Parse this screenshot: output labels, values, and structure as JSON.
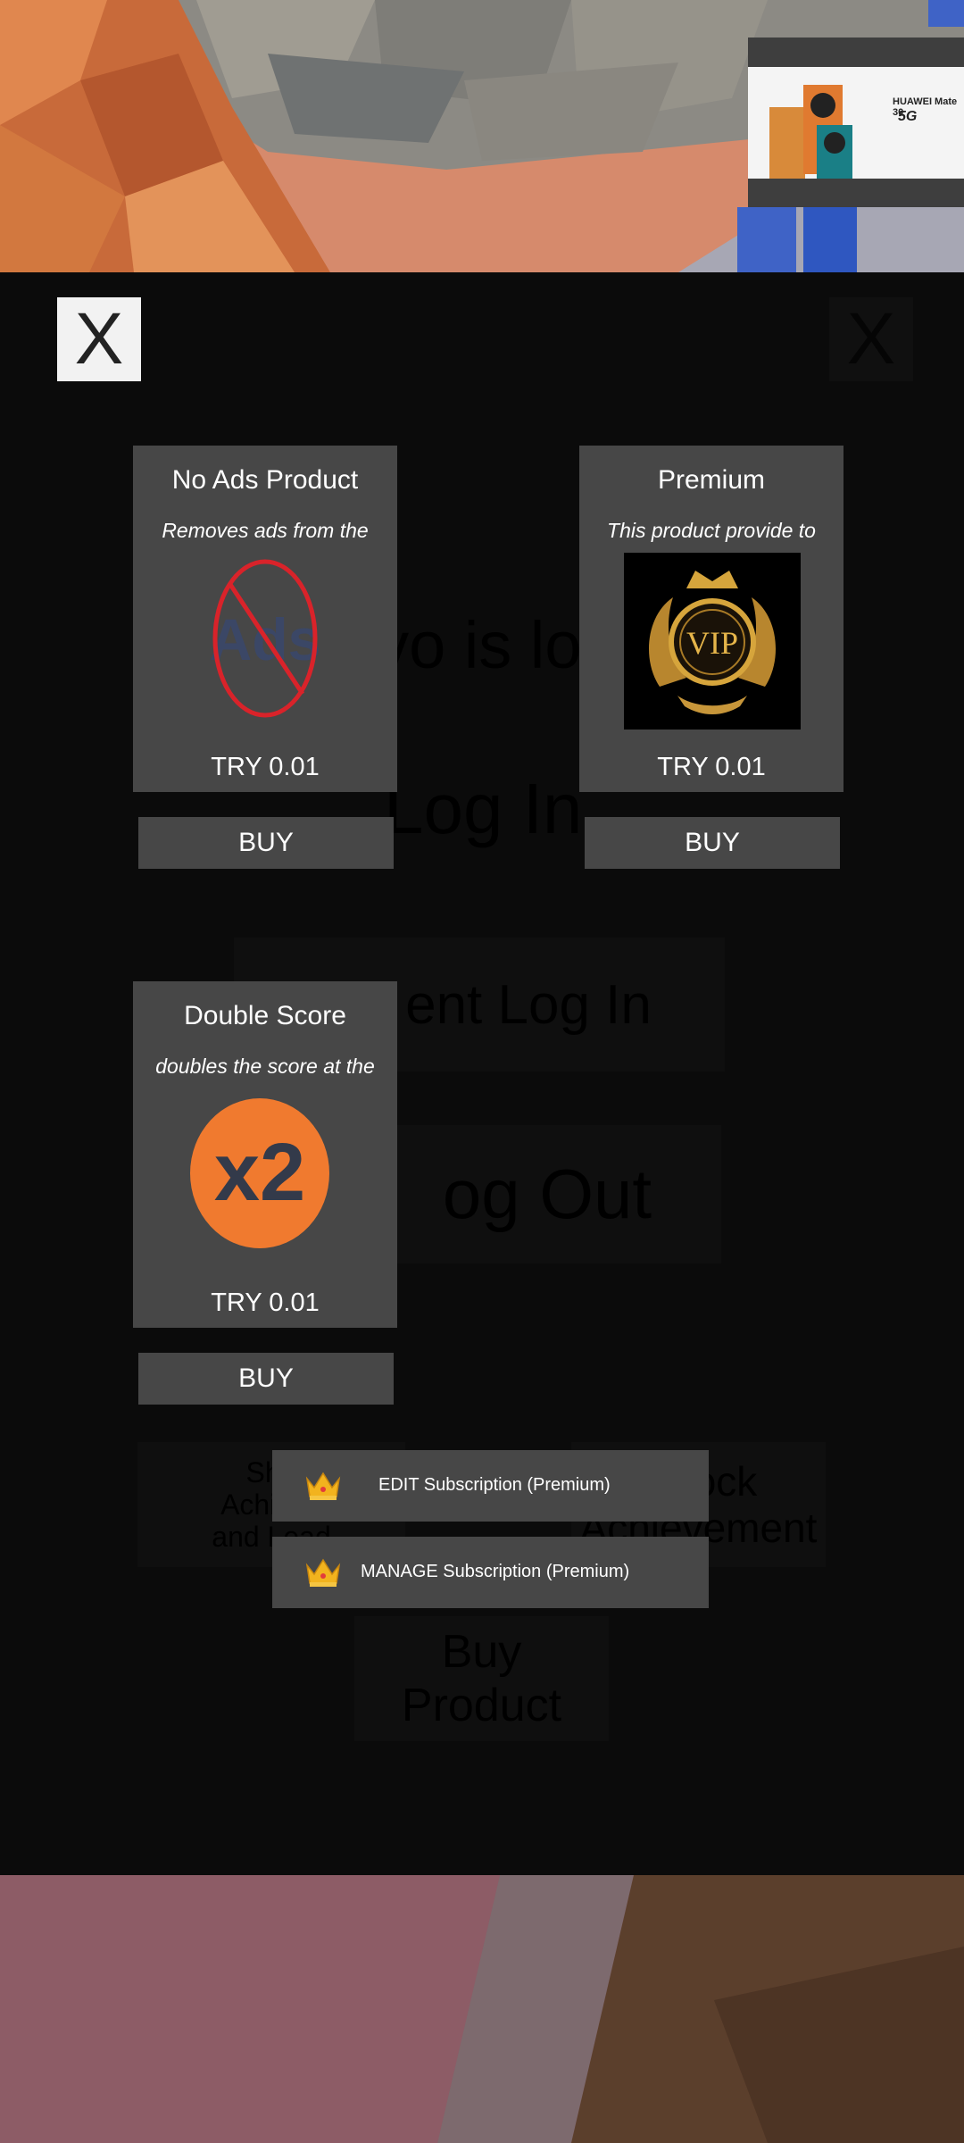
{
  "close_button_label": "X",
  "background_menu": {
    "line1": "ovo is lo",
    "log_in": "Log In",
    "silent_log_in": "ent Log In",
    "log_out": "og Out",
    "show_achievements": [
      "Sho",
      "Achieve",
      "and Lead"
    ],
    "unlock_achievement": [
      "ock",
      "Achievement"
    ],
    "buy_product": [
      "Buy",
      "Product"
    ]
  },
  "products": [
    {
      "title": "No Ads Product",
      "description": "Removes ads from the",
      "price": "TRY 0.01",
      "buy_label": "BUY",
      "icon": "no-ads-icon"
    },
    {
      "title": "Premium",
      "description": "This product provide to",
      "price": "TRY 0.01",
      "buy_label": "BUY",
      "icon": "vip-icon",
      "icon_text": "VIP"
    },
    {
      "title": "Double Score",
      "description": "doubles the score at the",
      "price": "TRY 0.01",
      "buy_label": "BUY",
      "icon": "x2-icon",
      "icon_text": "x2"
    }
  ],
  "no_ads_icon_text": "Ads",
  "subscriptions": [
    {
      "label": "EDIT Subscription (Premium)",
      "icon": "crown-icon"
    },
    {
      "label": "MANAGE Subscription (Premium)",
      "icon": "crown-icon"
    }
  ],
  "billboard": {
    "brand": "HUAWEI Mate 30",
    "tagline": "5G"
  },
  "colors": {
    "card_bg": "#474747",
    "overlay_bg": "#0b0b0b",
    "close_bg": "#f2f2f2",
    "x2_orange": "#f07a2f",
    "no_ads_red": "#d9232a"
  }
}
